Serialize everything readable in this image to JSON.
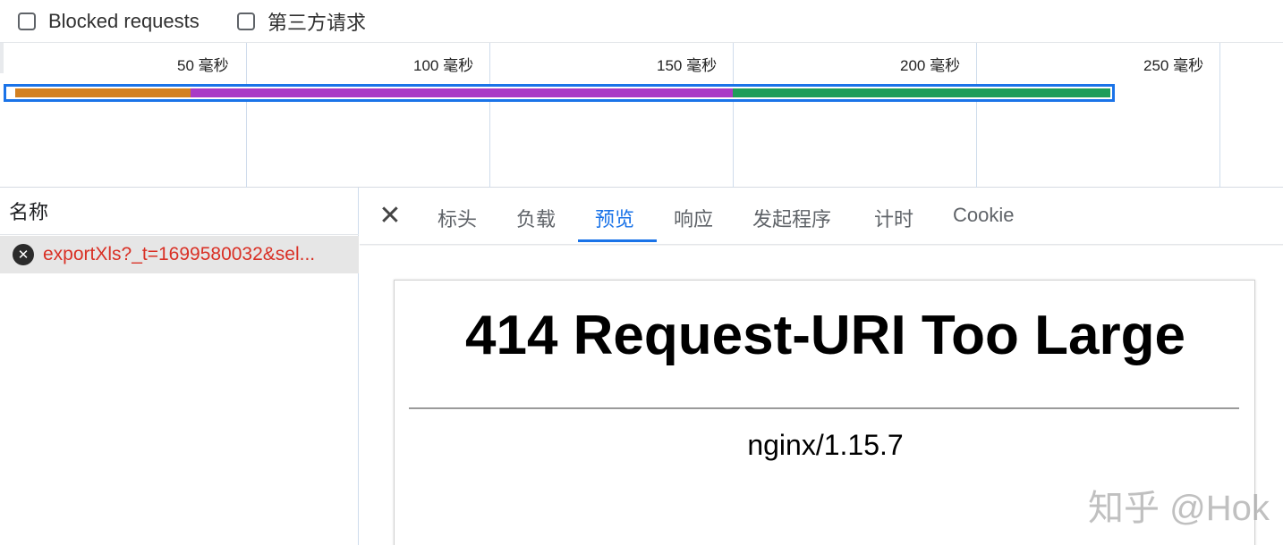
{
  "filters": {
    "blocked_requests": "Blocked requests",
    "third_party_requests": "第三方请求"
  },
  "timeline": {
    "ticks": [
      "50 毫秒",
      "100 毫秒",
      "150 毫秒",
      "200 毫秒",
      "250 毫秒"
    ],
    "segments": [
      {
        "name": "waiting",
        "color": "#ffffff"
      },
      {
        "name": "queueing",
        "color": "#d38121"
      },
      {
        "name": "waiting-server",
        "color": "#a93ac6"
      },
      {
        "name": "content-download",
        "color": "#1e9d5b"
      }
    ]
  },
  "request_list": {
    "column_header": "名称",
    "items": [
      {
        "name": "exportXls?_t=1699580032&sel...",
        "status": "error"
      }
    ]
  },
  "details": {
    "tabs": [
      "标头",
      "负载",
      "预览",
      "响应",
      "发起程序",
      "计时",
      "Cookie"
    ],
    "active_tab": "预览",
    "preview": {
      "heading": "414 Request-URI Too Large",
      "server": "nginx/1.15.7"
    }
  },
  "watermark": "知乎 @Hok",
  "colors": {
    "accent": "#1a73e8",
    "error": "#d93025"
  }
}
